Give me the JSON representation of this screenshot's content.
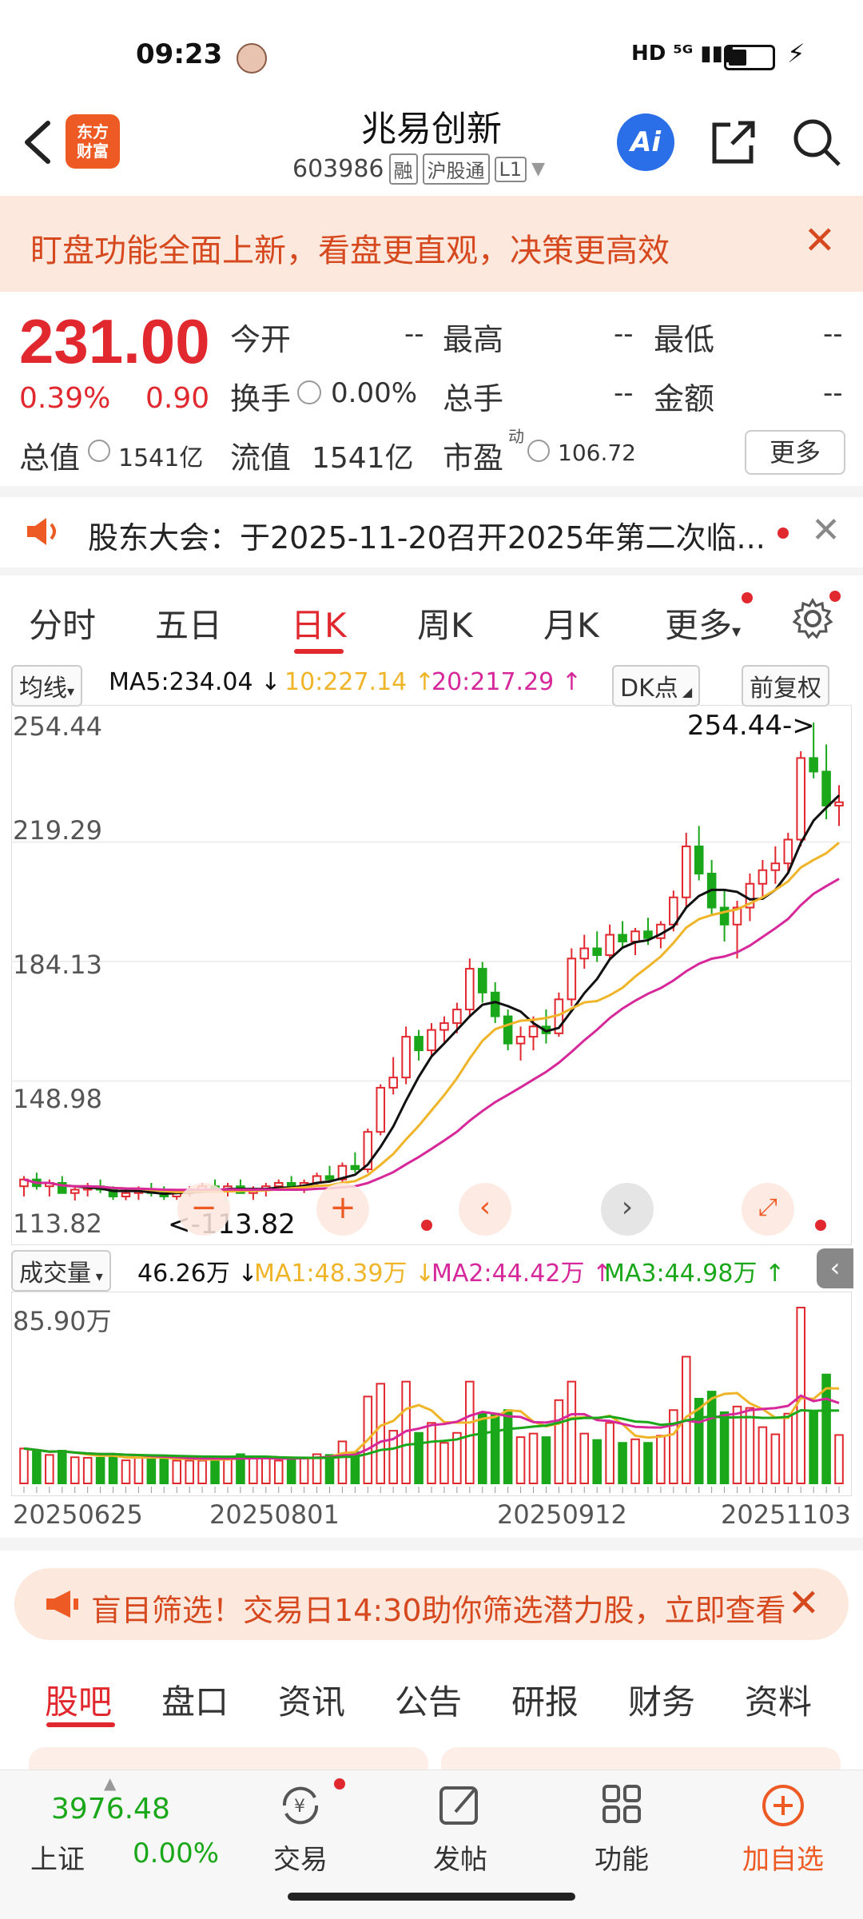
{
  "status_bar": {
    "time": "09:23",
    "network": "HD ⁵ᴳ ▮▮▮"
  },
  "header": {
    "title": "兆易创新",
    "code": "603986",
    "tags": [
      "融",
      "沪股通",
      "L1"
    ],
    "logo_text_1": "东方",
    "logo_text_2": "财富",
    "ai_label": "Ai"
  },
  "banner": {
    "text": "盯盘功能全面上新，看盘更直观，决策更高效"
  },
  "quote": {
    "price": "231.00",
    "change_pct": "0.39%",
    "change": "0.90",
    "open_label": "今开",
    "open": "--",
    "high_label": "最高",
    "high": "--",
    "low_label": "最低",
    "low": "--",
    "turnover_label": "换手",
    "turnover": "0.00%",
    "volume_label": "总手",
    "volume": "--",
    "amount_label": "金额",
    "amount": "--",
    "mcap_label": "总值",
    "mcap": "1541亿",
    "float_label": "流值",
    "float": "1541亿",
    "pe_label": "市盈",
    "pe_sup": "动",
    "pe": "106.72",
    "more_label": "更多"
  },
  "notice": {
    "text": "股东大会：于2025-11-20召开2025年第二次临..."
  },
  "kline_tabs": [
    "分时",
    "五日",
    "日K",
    "周K",
    "月K",
    "更多"
  ],
  "ma_row": {
    "label": "均线",
    "ma5": "MA5:234.04 ↓",
    "ma10": "10:227.14 ↑",
    "ma20": "20:217.29 ↑",
    "dk": "DK点",
    "adjust": "前复权"
  },
  "colors": {
    "up": "#e0282e",
    "down": "#1aa71a",
    "ma5": "#111111",
    "ma10": "#f0b429",
    "ma20": "#d6289a",
    "accent": "#ee5a24"
  },
  "chart_data": {
    "type": "candlestick",
    "y_ticks": [
      "254.44",
      "219.29",
      "184.13",
      "148.98",
      "113.82"
    ],
    "ylim": [
      113.82,
      254.44
    ],
    "max_annotation": "254.44->",
    "min_annotation": "<-113.82",
    "x_ticks": [
      "20250625",
      "20250801",
      "20250912",
      "20251103"
    ],
    "candles": [
      [
        118,
        121,
        115,
        120
      ],
      [
        120,
        122,
        117,
        118
      ],
      [
        118,
        120,
        115,
        119
      ],
      [
        119,
        121,
        117,
        116
      ],
      [
        116,
        118,
        113.82,
        117
      ],
      [
        117,
        119,
        115,
        118
      ],
      [
        118,
        120,
        116,
        117
      ],
      [
        117,
        118,
        114,
        115
      ],
      [
        115,
        117,
        113.9,
        116
      ],
      [
        116,
        118,
        114,
        117
      ],
      [
        117,
        119,
        115,
        116
      ],
      [
        116,
        118,
        114,
        115
      ],
      [
        115,
        117,
        114,
        116
      ],
      [
        116,
        118,
        115,
        117
      ],
      [
        117,
        119,
        116,
        118
      ],
      [
        118,
        120,
        116,
        117
      ],
      [
        117,
        119,
        115,
        118
      ],
      [
        118,
        120,
        116,
        116
      ],
      [
        116,
        118,
        114,
        117
      ],
      [
        117,
        119,
        115,
        118
      ],
      [
        118,
        120,
        117,
        119
      ],
      [
        119,
        121,
        117,
        118
      ],
      [
        118,
        120,
        116,
        119
      ],
      [
        119,
        122,
        118,
        121
      ],
      [
        121,
        124,
        119,
        120
      ],
      [
        120,
        125,
        119,
        124
      ],
      [
        124,
        128,
        122,
        123
      ],
      [
        123,
        135,
        122,
        134
      ],
      [
        134,
        148,
        133,
        147
      ],
      [
        147,
        156,
        145,
        150
      ],
      [
        150,
        165,
        148,
        162
      ],
      [
        162,
        164,
        155,
        158
      ],
      [
        158,
        166,
        156,
        164
      ],
      [
        164,
        168,
        160,
        166
      ],
      [
        166,
        172,
        163,
        170
      ],
      [
        170,
        185,
        168,
        182
      ],
      [
        182,
        184,
        172,
        175
      ],
      [
        175,
        178,
        166,
        168
      ],
      [
        168,
        170,
        158,
        160
      ],
      [
        160,
        165,
        155,
        162
      ],
      [
        162,
        168,
        158,
        165
      ],
      [
        165,
        170,
        160,
        163
      ],
      [
        163,
        175,
        162,
        173
      ],
      [
        173,
        188,
        171,
        185
      ],
      [
        185,
        192,
        182,
        188
      ],
      [
        188,
        193,
        184,
        186
      ],
      [
        186,
        195,
        185,
        192
      ],
      [
        192,
        196,
        188,
        190
      ],
      [
        190,
        194,
        186,
        193
      ],
      [
        193,
        197,
        189,
        191
      ],
      [
        191,
        196,
        188,
        195
      ],
      [
        195,
        205,
        193,
        203
      ],
      [
        203,
        222,
        200,
        218
      ],
      [
        218,
        224,
        208,
        210
      ],
      [
        210,
        214,
        198,
        200
      ],
      [
        200,
        205,
        190,
        195
      ],
      [
        195,
        202,
        185,
        200
      ],
      [
        200,
        210,
        196,
        207
      ],
      [
        207,
        214,
        203,
        211
      ],
      [
        211,
        218,
        207,
        213
      ],
      [
        213,
        222,
        210,
        220
      ],
      [
        220,
        246,
        218,
        244
      ],
      [
        244,
        254.44,
        238,
        240
      ],
      [
        240,
        248,
        226,
        230
      ],
      [
        230,
        236,
        224,
        231
      ]
    ]
  },
  "volume_row": {
    "label": "成交量",
    "current": "46.26万 ↓",
    "ma1": "MA1:48.39万 ↓",
    "ma2": "MA2:44.42万 ↑",
    "ma3": "MA3:44.98万 ↑",
    "max_label": "85.90万"
  },
  "promo": {
    "text": "盲目筛选！交易日14:30助你筛选潜力股，立即查看"
  },
  "bottom_tabs": [
    "股吧",
    "盘口",
    "资讯",
    "公告",
    "研报",
    "财务",
    "资料"
  ],
  "nav": {
    "index_value": "3976.48",
    "index_name": "上证",
    "index_change": "0.00%",
    "items": [
      "交易",
      "发帖",
      "功能",
      "加自选"
    ]
  }
}
